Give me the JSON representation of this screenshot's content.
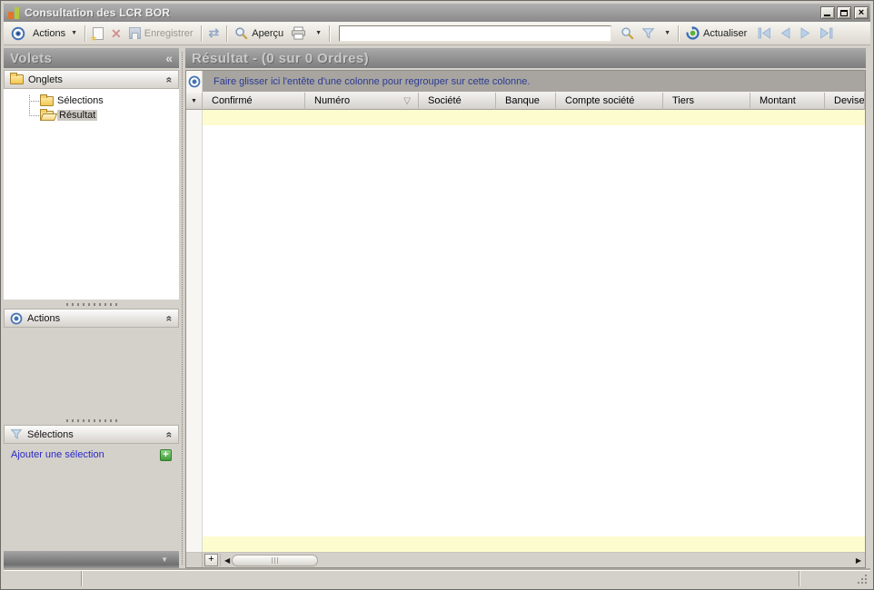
{
  "window": {
    "title": "Consultation des LCR BOR"
  },
  "toolbar": {
    "actions_label": "Actions",
    "save_label": "Enregistrer",
    "preview_label": "Aperçu",
    "refresh_label": "Actualiser",
    "search_value": ""
  },
  "sidebar": {
    "title": "Volets",
    "onglets_label": "Onglets",
    "tree": [
      {
        "label": "Sélections"
      },
      {
        "label": "Résultat"
      }
    ],
    "actions_label": "Actions",
    "selections_label": "Sélections",
    "add_selection_label": "Ajouter une sélection"
  },
  "main": {
    "title": "Résultat - (0 sur 0 Ordres)",
    "group_hint": "Faire glisser ici l'entête d'une colonne pour regrouper sur cette colonne.",
    "columns": [
      "Confirmé",
      "Numéro",
      "Société",
      "Banque",
      "Compte société",
      "Tiers",
      "Montant",
      "Devise"
    ],
    "sorted_column": "Numéro",
    "record_count": "0 sur 0"
  },
  "glyphs": {
    "collapse_left": "«",
    "section_collapse": "«",
    "dropdown": "▼",
    "sort_desc": "▽",
    "row_dropdown": "▼",
    "close": "×",
    "plus": "+",
    "scroll_left": "◀",
    "scroll_right": "▶",
    "sync": "⇄",
    "footer_collapse": "▼"
  },
  "colors": {
    "row_highlight": "#FCFCCE",
    "link_blue": "#2A2AC8",
    "group_hint_blue": "#2B3A94",
    "header_gray": "#8A8A8A",
    "toolbar_bg": "#ECE8E0"
  }
}
